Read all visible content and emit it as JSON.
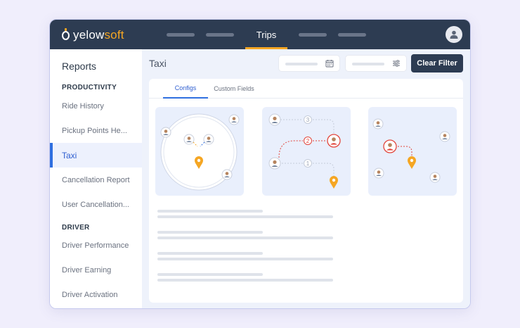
{
  "app": {
    "logo_prefix": "yelow",
    "logo_suffix": "soft",
    "nav_active_label": "Trips"
  },
  "sidebar": {
    "title": "Reports",
    "groups": [
      {
        "label": "PRODUCTIVITY",
        "items": [
          "Ride History",
          "Pickup Points He...",
          "Taxi",
          "Cancellation Report",
          "User Cancellation..."
        ]
      },
      {
        "label": "DRIVER",
        "items": [
          "Driver Performance",
          "Driver Earning",
          "Driver Activation"
        ]
      }
    ],
    "active_item": "Taxi"
  },
  "main": {
    "title": "Taxi",
    "clear_filter_label": "Clear Filter",
    "tabs": [
      {
        "label": "Configs",
        "active": true
      },
      {
        "label": "Custom Fields",
        "active": false
      }
    ],
    "configs": [
      {
        "name": "radius-dispatch"
      },
      {
        "name": "sequential-dispatch",
        "steps": [
          "3",
          "2",
          "1"
        ]
      },
      {
        "name": "nearest-dispatch"
      }
    ]
  },
  "colors": {
    "topbar": "#2d3c52",
    "accent_orange": "#f5a623",
    "accent_blue": "#2f6fe0",
    "alert_red": "#e2453c"
  },
  "icons": [
    "user-avatar-icon",
    "calendar-icon",
    "sliders-icon",
    "map-pin-icon",
    "driver-icon"
  ]
}
